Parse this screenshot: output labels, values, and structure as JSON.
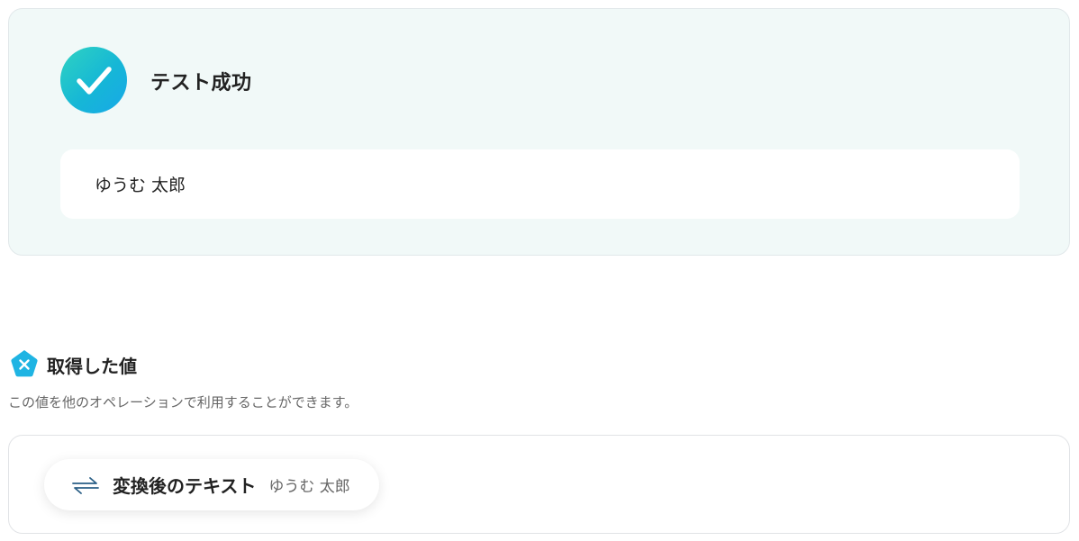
{
  "success": {
    "title": "テスト成功",
    "result_value": "ゆうむ 太郎"
  },
  "section": {
    "title": "取得した値",
    "description": "この値を他のオペレーションで利用することができます。"
  },
  "values": [
    {
      "label": "変換後のテキスト",
      "value": "ゆうむ 太郎"
    }
  ],
  "colors": {
    "accent_teal": "#2fd3c1",
    "accent_blue": "#18a8e8",
    "card_bg": "#f1f9f8"
  }
}
